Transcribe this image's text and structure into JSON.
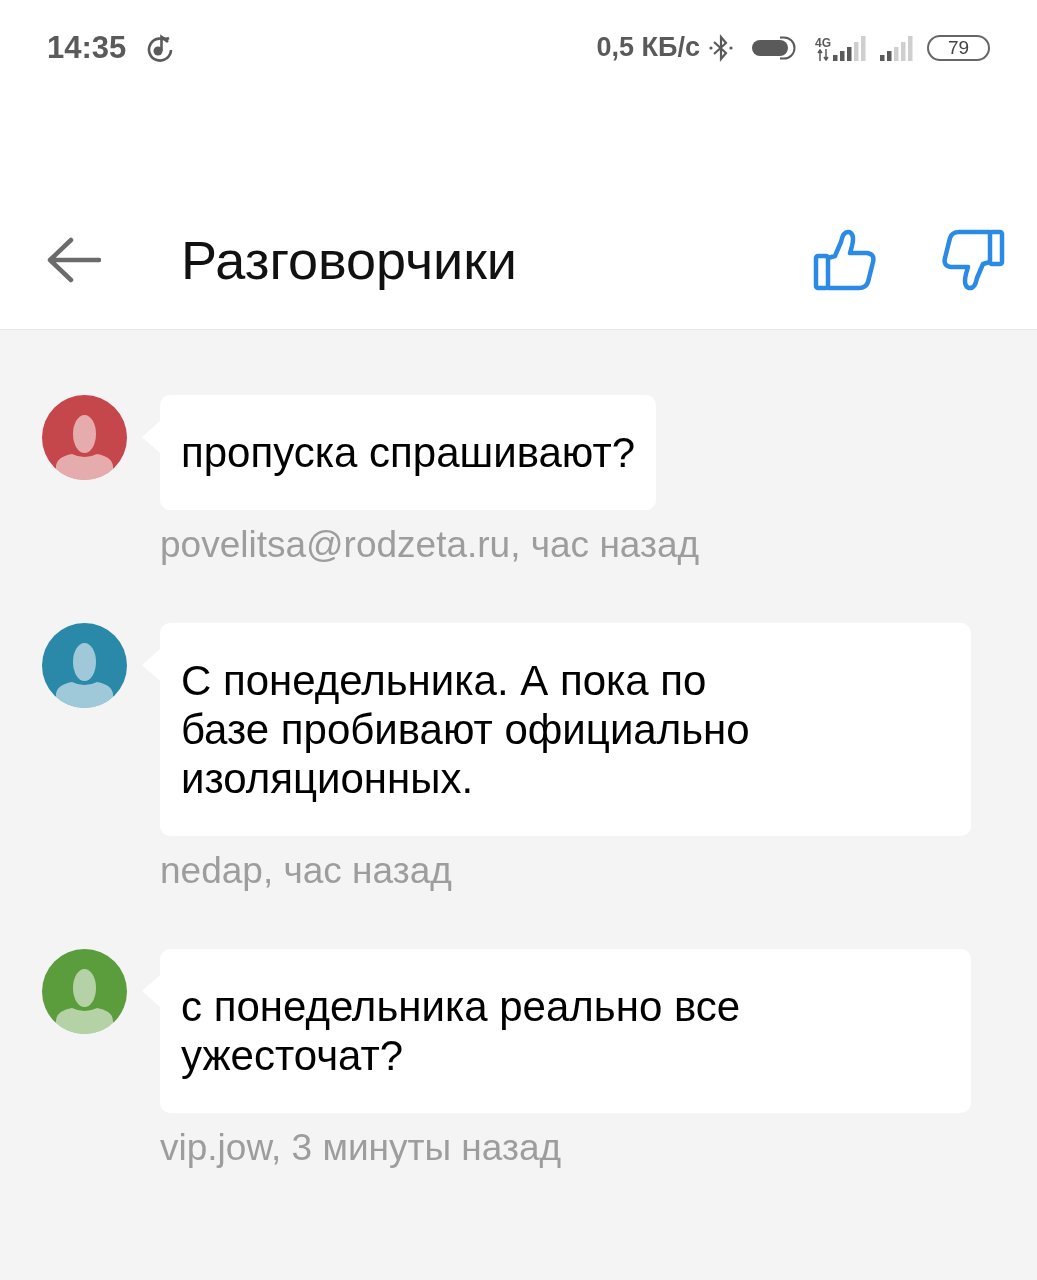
{
  "status_bar": {
    "time": "14:35",
    "network_speed": "0,5 КБ/с",
    "network_type": "4G",
    "battery": "79"
  },
  "header": {
    "title": "Разговорчики"
  },
  "messages": [
    {
      "color": "#c5464b",
      "lines": [
        "пропуска спрашивают?"
      ],
      "meta": "povelitsa@rodzeta.ru, час назад"
    },
    {
      "color": "#2a88a8",
      "lines": [
        "С понедельника. А пока по",
        "базе пробивают официально",
        "изоляционных."
      ],
      "meta": "nedap, час назад"
    },
    {
      "color": "#5b9c3d",
      "lines": [
        "с понедельника реально все",
        "ужесточат?"
      ],
      "meta": "vip.jow, 3 минуты назад"
    }
  ]
}
